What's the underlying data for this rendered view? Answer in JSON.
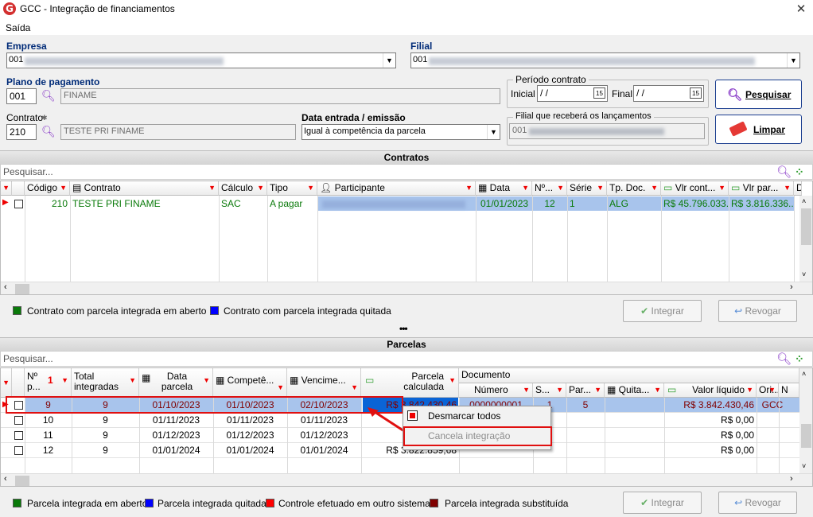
{
  "window": {
    "title": "GCC - Integração de financiamentos",
    "close": "✕"
  },
  "menu": {
    "exit": "Saída"
  },
  "empresa": {
    "label": "Empresa",
    "value": "001"
  },
  "filial": {
    "label": "Filial",
    "value": "001"
  },
  "plano": {
    "label": "Plano de pagamento",
    "code": "001",
    "name": "FINAME"
  },
  "contrato": {
    "label": "Contrato",
    "code": "210",
    "name": "TESTE PRI FINAME"
  },
  "data_entrada": {
    "label": "Data entrada / emissão",
    "value": "Igual à competência da parcela"
  },
  "periodo": {
    "label": "Período contrato",
    "inicial_label": "Inicial",
    "inicial_value": "/ /",
    "final_label": "Final",
    "final_value": "/ /",
    "cal": "15"
  },
  "filial_lanc": {
    "label": "Filial que receberá os lançamentos",
    "value": "001"
  },
  "buttons": {
    "pesquisar": "Pesquisar",
    "limpar": "Limpar",
    "integrar": "Integrar",
    "revogar": "Revogar"
  },
  "contratos": {
    "title": "Contratos",
    "search_placeholder": "Pesquisar...",
    "headers": [
      "Código",
      "Contrato",
      "Cálculo",
      "Tipo",
      "Participante",
      "Data",
      "Nº...",
      "Série",
      "Tp. Doc.",
      "Vlr cont...",
      "Vlr par...",
      "D"
    ],
    "row": {
      "codigo": "210",
      "contrato": "TESTE PRI FINAME",
      "calculo": "SAC",
      "tipo": "A pagar",
      "data": "01/01/2023",
      "n": "12",
      "serie": "1",
      "tpdoc": "ALG",
      "vlr_cont": "R$ 45.796.033...",
      "vlr_par": "R$ 3.816.336..."
    }
  },
  "legend_contratos": [
    {
      "label": "Contrato com parcela integrada em aberto",
      "color": "#0a7a0a"
    },
    {
      "label": "Contrato com parcela integrada quitada",
      "color": "#0000ff"
    }
  ],
  "splitter": "•••",
  "parcelas": {
    "title": "Parcelas",
    "search_placeholder": "Pesquisar...",
    "headers": {
      "num": "Nº p...",
      "total": "Total integradas",
      "data_parcela": "Data parcela",
      "competencia": "Competê...",
      "vencimento": "Vencime...",
      "parcela_calc": "Parcela calculada",
      "documento": "Documento",
      "numero": "Número",
      "s": "S...",
      "par": "Par...",
      "quita": "Quita...",
      "valor_liquido": "Valor líquido",
      "ori": "Ori...",
      "n": "N"
    },
    "rows": [
      {
        "num": "9",
        "total": "9",
        "data": "01/10/2023",
        "comp": "01/10/2023",
        "venc": "02/10/2023",
        "calc": "R$ 3.842.430,46",
        "numero": "0000000001",
        "s": "1",
        "par": "5",
        "liquido": "R$ 3.842.430,46",
        "ori": "GCC"
      },
      {
        "num": "10",
        "total": "9",
        "data": "01/11/2023",
        "comp": "01/11/2023",
        "venc": "01/11/2023",
        "calc": "",
        "numero": "",
        "s": "",
        "par": "",
        "liquido": "R$ 0,00",
        "ori": ""
      },
      {
        "num": "11",
        "total": "9",
        "data": "01/12/2023",
        "comp": "01/12/2023",
        "venc": "01/12/2023",
        "calc": "",
        "numero": "",
        "s": "",
        "par": "",
        "liquido": "R$ 0,00",
        "ori": ""
      },
      {
        "num": "12",
        "total": "9",
        "data": "01/01/2024",
        "comp": "01/01/2024",
        "venc": "01/01/2024",
        "calc": "R$ 3.822.859,68",
        "numero": "",
        "s": "",
        "par": "",
        "liquido": "R$ 0,00",
        "ori": ""
      }
    ],
    "sort_badge": "1"
  },
  "context_menu": {
    "item1": "Desmarcar todos",
    "item2": "Cancela integração"
  },
  "legend_parcelas": [
    {
      "label": "Parcela integrada em aberto",
      "color": "#0a7a0a"
    },
    {
      "label": "Parcela integrada quitada",
      "color": "#0000ff"
    },
    {
      "label": "Controle efetuado em outro sistema",
      "color": "#ff0000"
    },
    {
      "label": "Parcela integrada substituída",
      "color": "#800000"
    }
  ]
}
